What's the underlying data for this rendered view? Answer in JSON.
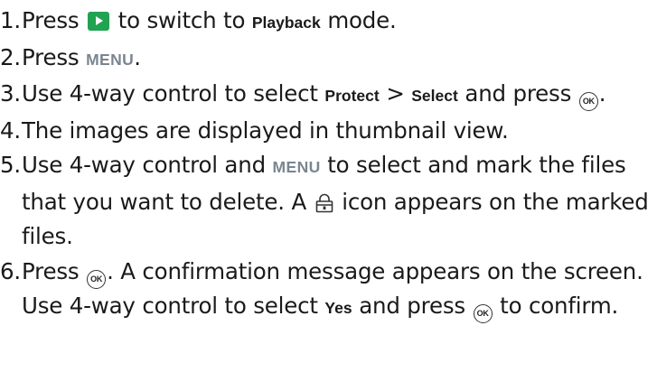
{
  "steps": [
    {
      "number": "1.",
      "text_before": "Press",
      "text_middle": "to switch to",
      "keyword": "Playback",
      "text_after": "mode."
    },
    {
      "number": "2.",
      "text_before": "Press",
      "keyword": "MENU",
      "text_after": "."
    },
    {
      "number": "3.",
      "text_before": "Use 4-way control to select",
      "keyword1": "Protect",
      "separator": ">",
      "keyword2": "Select",
      "text_middle": "and press",
      "text_after": "."
    },
    {
      "number": "4.",
      "text": "The images are displayed in thumbnail view."
    },
    {
      "number": "5.",
      "text_before": "Use 4-way control and",
      "keyword": "MENU",
      "text_middle": "to select and mark the files that you want to delete. A",
      "text_after": "icon appears on the marked files."
    },
    {
      "number": "6.",
      "text_before": "Press",
      "text_middle": ". A confirmation message appears on the screen. Use 4-way control to select",
      "keyword": "Yes",
      "text_middle2": "and press",
      "text_after": "to confirm."
    }
  ],
  "icons": {
    "playback": "playback-icon",
    "ok": "ok-button-icon",
    "ok_label": "OK",
    "protect": "protect-lock-icon"
  },
  "colors": {
    "playback_icon": "#21a351",
    "menu_text": "#7b8590",
    "body_text": "#1a1a1a"
  }
}
